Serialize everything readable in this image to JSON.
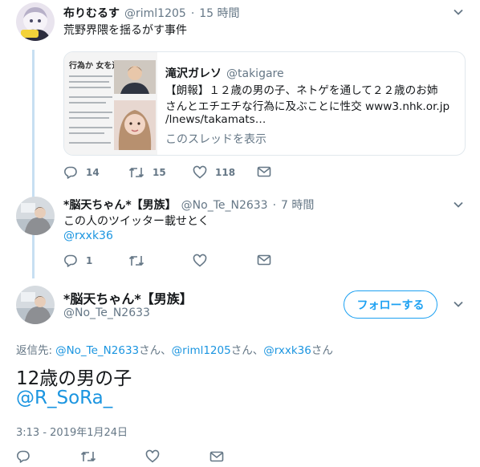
{
  "tweet1": {
    "display_name": "布りむるす",
    "handle": "@riml1205",
    "sep": "·",
    "time": "15 時間",
    "text": "荒野界隈を揺るがす事件",
    "quote": {
      "display_name": "滝沢ガレソ",
      "handle": "@takigare",
      "text_lines": [
        "【朗報】１２歳の男の子、ネトゲを通して２２歳のお姉",
        "さんとエチエチな行為に及ぶことに性交 www3.nhk.or.jp",
        "/lnews/takamats…"
      ],
      "show_thread": "このスレッドを表示",
      "image_heading": "行為か 女を逮捕"
    },
    "reply_count": "14",
    "retweet_count": "15",
    "like_count": "118"
  },
  "tweet2": {
    "display_name": "*脳天ちゃん*【男族】",
    "handle": "@No_Te_N2633",
    "sep": "·",
    "time": "7 時間",
    "text": "この人のツイッター載せとく",
    "mention": "@rxxk36",
    "reply_count": "1"
  },
  "main": {
    "display_name": "*脳天ちゃん*【男族】",
    "handle": "@No_Te_N2633",
    "follow_label": "フォローする",
    "reply_to_label": "返信先:",
    "reply_to": [
      {
        "handle": "@No_Te_N2633",
        "suffix": "さん、"
      },
      {
        "handle": "@riml1205",
        "suffix": "さん、"
      },
      {
        "handle": "@rxxk36",
        "suffix": "さん"
      }
    ],
    "text_line1": "12歳の男の子",
    "text_line2": "@R_SoRa_",
    "timestamp": "3:13 - 2019年1月24日"
  },
  "colors": {
    "accent": "#1da1f2",
    "link": "#1b95e0",
    "secondary_text": "#657786",
    "thread_line": "#c7dff2",
    "border": "#e1e8ed"
  },
  "icons": [
    "chevron-down-icon",
    "reply-icon",
    "retweet-icon",
    "heart-icon",
    "mail-icon"
  ]
}
